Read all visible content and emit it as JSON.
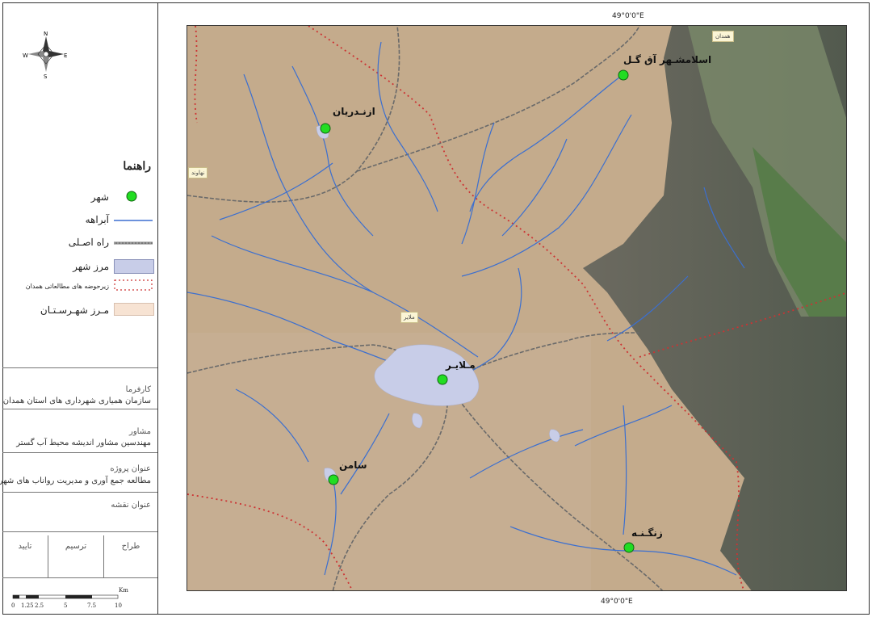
{
  "north_arrow": {
    "n": "N",
    "s": "S",
    "e": "E",
    "w": "W"
  },
  "legend": {
    "title": "راهنما",
    "items": [
      {
        "label": "شهر",
        "symbol": "city-dot"
      },
      {
        "label": "آبراهه",
        "symbol": "stream-line"
      },
      {
        "label": "راه اصـلی",
        "symbol": "road-line"
      },
      {
        "label": "مرز شهر",
        "symbol": "city-boundary"
      },
      {
        "label": "زیرحوضه های مطالعاتی همدان",
        "symbol": "subbasin-boundary"
      },
      {
        "label": "مـرز شهـرسـتـان",
        "symbol": "county-boundary"
      }
    ]
  },
  "info": {
    "client_label": "کارفرما",
    "client_value": "سازمان همیاری شهرداری های استان همدان",
    "consultant_label": "مشاور",
    "consultant_value": "مهندسین مشاور اندیشه محیط آب گستر",
    "project_label": "عنوان پروژه",
    "project_value": "مطالعه جمع آوری و مدیریت رواناب های شهری",
    "map_title_label": "عنوان نقشه",
    "designer_label": "طراح",
    "drafter_label": "ترسیم",
    "approver_label": "تایید"
  },
  "scale_bar": {
    "ticks": [
      "0",
      "1.25",
      "2.5",
      "5",
      "7.5",
      "10"
    ],
    "unit": "Km"
  },
  "graticule": {
    "top": "49°0'0\"E",
    "bottom": "49°0'0\"E"
  },
  "map_tags": [
    "همدان",
    "نهاوند",
    "ملایر"
  ],
  "cities": [
    {
      "name": "ازنـدریان"
    },
    {
      "name": "اسلامشـهر آق گـل"
    },
    {
      "name": "مـلایـر"
    },
    {
      "name": "سامن"
    },
    {
      "name": "زنگـنـه"
    }
  ],
  "colors": {
    "terrain": "#c2a98a",
    "mountain": "#5f625a",
    "stream": "#3b6fd0",
    "city_fill": "#22dd22",
    "city_boundary_fill": "#c8cde8",
    "subbasin": "#cc3333",
    "road": "#666666",
    "county_fill": "#f7e3d3"
  }
}
